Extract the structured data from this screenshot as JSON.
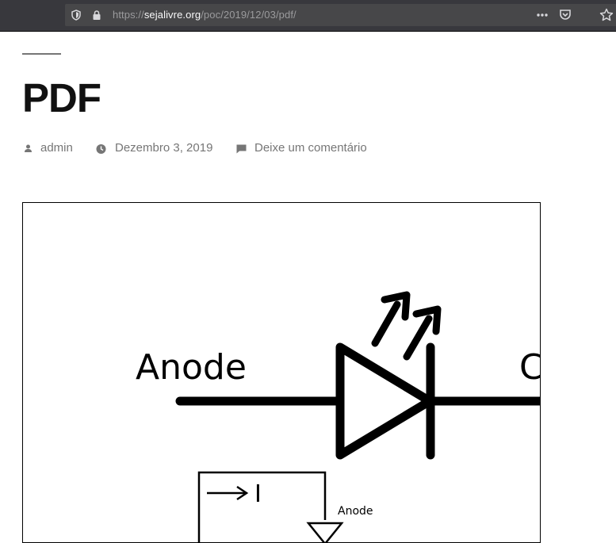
{
  "browser": {
    "url_scheme": "https://",
    "url_host": "sejalivre.org",
    "url_path": "/poc/2019/12/03/pdf/",
    "icons": [
      "tracking-shield-icon",
      "lock-icon",
      "page-actions-icon",
      "pocket-icon",
      "bookmark-star-icon"
    ]
  },
  "post": {
    "title": "PDF",
    "author": "admin",
    "date": "Dezembro 3, 2019",
    "comment_link": "Deixe um comentário"
  },
  "diagram": {
    "anode_label": "Anode",
    "cathode_partial_label": "C",
    "current_label": "I",
    "small_anode_label": "Anode"
  },
  "colors": {
    "toolbar_bg": "#38383d",
    "urlbar_bg": "#474749",
    "meta_text": "#767676",
    "title_text": "#111111"
  }
}
